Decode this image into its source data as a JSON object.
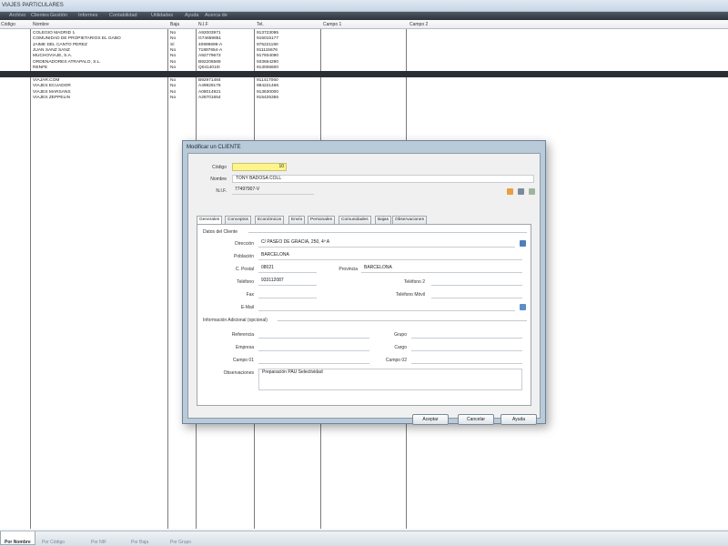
{
  "window": {
    "title": "VIAJES PARTICULARES"
  },
  "menu": [
    "Archivo",
    "Clientes",
    "Gestión",
    "Informes",
    "Contabilidad",
    "Utilidades",
    "Ayuda",
    "Acerca de"
  ],
  "grid": {
    "columns": [
      "Código",
      "Nombre",
      "Baja",
      "N.I.F",
      "Tel.",
      "Campo 1",
      "Campo 2"
    ],
    "rows": [
      [
        "",
        "COLEGIO MADRID 1",
        "No",
        "A92003971",
        "913723095",
        "",
        ""
      ],
      [
        "",
        "COMUNIDAD DE PROPIETARIOS EL GABO",
        "No",
        "G74659851",
        "915015177",
        "",
        ""
      ],
      [
        "",
        "JAIME DEL CANTO PEREZ",
        "Sí",
        "40999699-A",
        "975221190",
        "",
        ""
      ],
      [
        "",
        "JUAN SANZ SANZ",
        "No",
        "71897654-A",
        "911115676",
        "",
        ""
      ],
      [
        "",
        "MUCHOVIAJE, S.A.",
        "No",
        "A92779673",
        "917934090",
        "",
        ""
      ],
      [
        "",
        "ORDENADORES ATRAPALO, S.L.",
        "No",
        "B92206569",
        "933664290",
        "",
        ""
      ],
      [
        "",
        "RENFE",
        "No",
        "Q0414010I",
        "913006600",
        "",
        ""
      ],
      [
        "",
        "TONY BADOSA COLL",
        "No",
        "77497907-V",
        "933112087",
        "",
        ""
      ],
      [
        "",
        "VIAJAR.COM",
        "No",
        "B92971484",
        "911417060",
        "",
        ""
      ],
      [
        "",
        "VIAJES ECUADOR",
        "No",
        "A49929176",
        "984221466",
        "",
        ""
      ],
      [
        "",
        "VIAJES MARSANS",
        "No",
        "A08014921",
        "913630000",
        "",
        ""
      ],
      [
        "",
        "VIAJES ZEPPELIN",
        "No",
        "A28701654",
        "915425356",
        "",
        ""
      ]
    ]
  },
  "dialog": {
    "title": "Modificar un CLIENTE",
    "codigo": {
      "label": "Código",
      "value": "10"
    },
    "nombre": {
      "label": "Nombre",
      "value": "TONY BADOSA COLL"
    },
    "nif": {
      "label": "N.I.F.",
      "value": "77497907-V"
    },
    "tabs": [
      "Generales",
      "Conceptos",
      "Económicos",
      "Envío",
      "Personales",
      "Comunidades",
      "Bajas",
      "Observaciones"
    ],
    "datos_title": "Datos del Cliente",
    "direccion": {
      "label": "Dirección",
      "value": "C/ PASEO DE GRACIA, 250, 4º A"
    },
    "poblacion": {
      "label": "Población",
      "value": "BARCELONA"
    },
    "cpostal": {
      "label": "C. Postal",
      "value": "08021"
    },
    "provincia": {
      "label": "Provincia",
      "value": "BARCELONA"
    },
    "telefono": {
      "label": "Teléfono",
      "value": "933112087"
    },
    "telefono2": {
      "label": "Teléfono 2",
      "value": ""
    },
    "fax": {
      "label": "Fax",
      "value": ""
    },
    "movil": {
      "label": "Teléfono Móvil",
      "value": ""
    },
    "email": {
      "label": "E-Mail",
      "value": ""
    },
    "adicional_title": "Información Adicional (opcional)",
    "referencia": {
      "label": "Referencia",
      "value": ""
    },
    "grupo": {
      "label": "Grupo",
      "value": ""
    },
    "empresa": {
      "label": "Empresa",
      "value": ""
    },
    "cargo": {
      "label": "Cargo",
      "value": ""
    },
    "campo01": {
      "label": "Campo 01",
      "value": ""
    },
    "campo02": {
      "label": "Campo 02",
      "value": ""
    },
    "observaciones": {
      "label": "Observaciones",
      "value": "Preparación PAU Selectividad"
    },
    "buttons": {
      "aceptar": "Aceptar",
      "cancelar": "Cancelar",
      "ayuda": "Ayuda"
    },
    "colors": {
      "code_bg": "#fdf48c",
      "frame": "#b9cad9"
    }
  },
  "bottom_tabs": [
    "Por Nombre",
    "Por Código",
    "Por NIF",
    "Por Baja",
    "Por Grupo"
  ],
  "icons": [
    "folder-icon",
    "camera-icon",
    "document-icon",
    "map-icon",
    "email-icon"
  ]
}
